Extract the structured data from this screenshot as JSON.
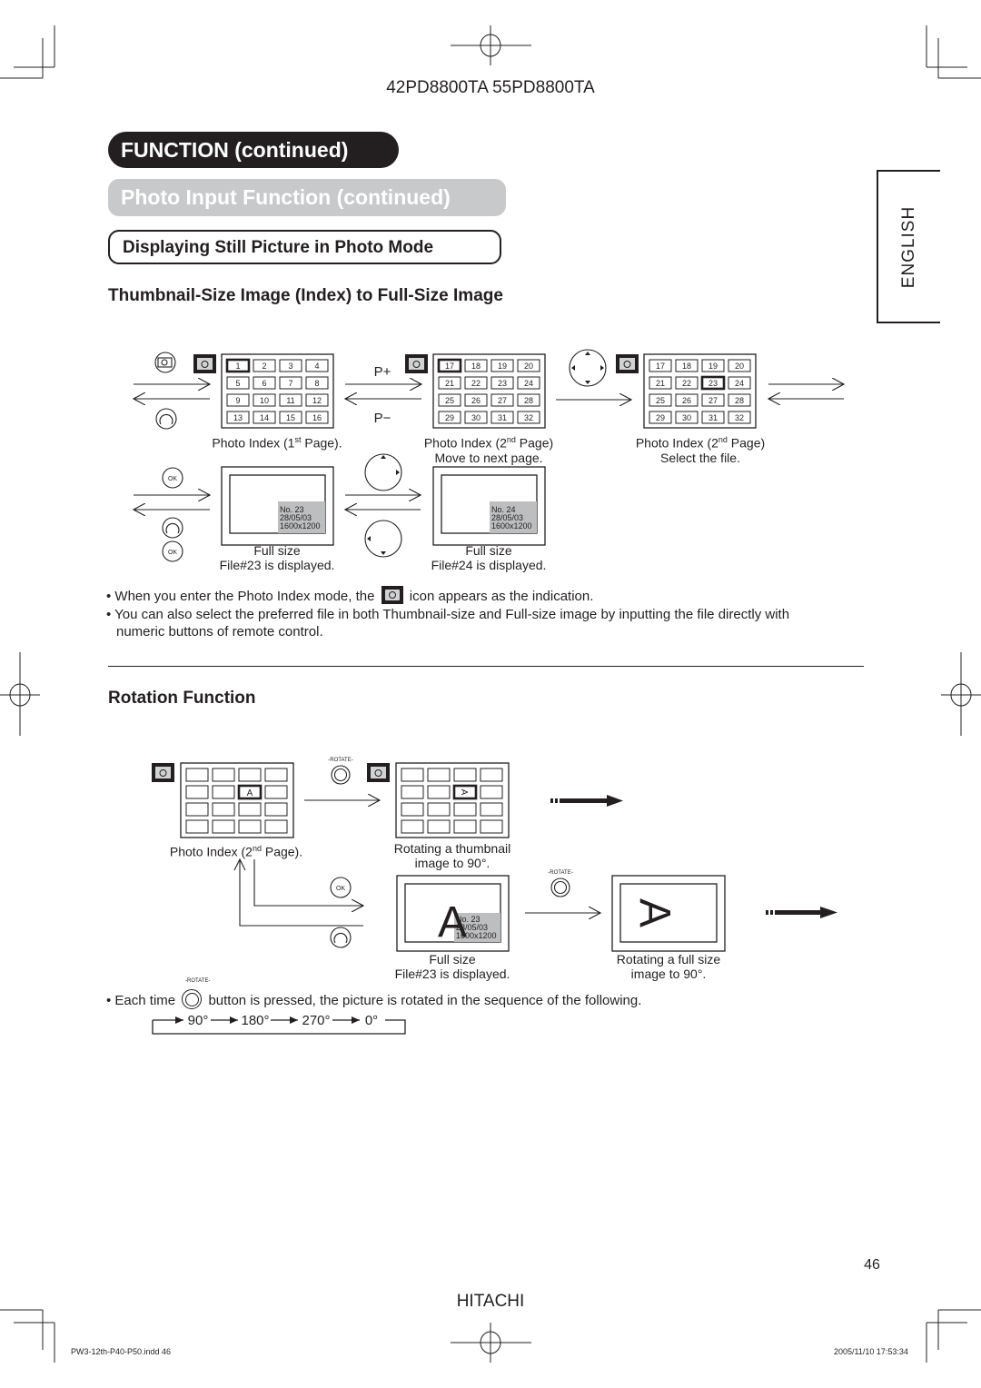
{
  "header": {
    "model": "42PD8800TA  55PD8800TA"
  },
  "sections": {
    "function_title": "FUNCTION (continued)",
    "photo_input_title": "Photo Input Function (continued)",
    "still_picture_title": "Displaying Still Picture in Photo Mode",
    "thumbnail_heading": "Thumbnail-Size Image (Index) to Full-Size Image",
    "rotation_heading": "Rotation Function"
  },
  "language_tab": "ENGLISH",
  "index_diagram": {
    "page_up_label": "P+",
    "page_down_label": "P−",
    "grid1": [
      "1",
      "2",
      "3",
      "4",
      "5",
      "6",
      "7",
      "8",
      "9",
      "10",
      "11",
      "12",
      "13",
      "14",
      "15",
      "16"
    ],
    "grid2": [
      "17",
      "18",
      "19",
      "20",
      "21",
      "22",
      "23",
      "24",
      "25",
      "26",
      "27",
      "28",
      "29",
      "30",
      "31",
      "32"
    ],
    "grid1_selected": "1",
    "grid2_selected": "17",
    "grid3_selected": "23",
    "captions": {
      "index1_a": "Photo Index (1",
      "index1_sup": "st",
      "index1_b": " Page).",
      "index2_a": "Photo Index (2",
      "index2_sup": "nd",
      "index2_b": " Page)",
      "index2_line2": "Move to next page.",
      "index3_a": "Photo Index (2",
      "index3_sup": "nd",
      "index3_b": " Page)",
      "index3_line2": "Select the file.",
      "full1_line1": "Full size",
      "full1_line2": "File#23 is displayed.",
      "full2_line1": "Full size",
      "full2_line2": "File#24 is displayed."
    },
    "ok_label": "OK",
    "full1_info": [
      "No. 23",
      "28/05/03",
      "1600x1200"
    ],
    "full2_info": [
      "No. 24",
      "28/05/03",
      "1600x1200"
    ]
  },
  "notes": {
    "bullet1_a": "• When you enter the Photo Index mode, the ",
    "bullet1_b": " icon appears as the indication.",
    "bullet2_line1": "• You can also select the preferred file in both Thumbnail-size and Full-size image by inputting the file directly with",
    "bullet2_line2": "numeric buttons of remote control."
  },
  "rotation_diagram": {
    "rotate_label": "-ROTATE-",
    "thumb_letter": "A",
    "rotated_thumb_letter": "A",
    "full_letter": "A",
    "ok_label": "OK",
    "full_info": [
      "No. 23",
      "28/05/03",
      "1600x1200"
    ],
    "captions": {
      "index_a": "Photo Index (2",
      "index_sup": "nd",
      "index_b": " Page).",
      "rot_thumb_line1": "Rotating a thumbnail",
      "rot_thumb_line2": "image to 90°.",
      "full_line1": "Full size",
      "full_line2": "File#23 is displayed.",
      "rot_full_line1": "Rotating a full size",
      "rot_full_line2": "image to 90°."
    },
    "sequence_note_a": "• Each time ",
    "sequence_note_b": " button is pressed, the picture is rotated in the sequence of the following.",
    "sequence": [
      "90°",
      "180°",
      "270°",
      "0°"
    ]
  },
  "footer": {
    "page_number": "46",
    "brand": "HITACHI",
    "file_info": "PW3-12th-P40-P50.indd   46",
    "timestamp": "2005/11/10   17:53:34"
  }
}
